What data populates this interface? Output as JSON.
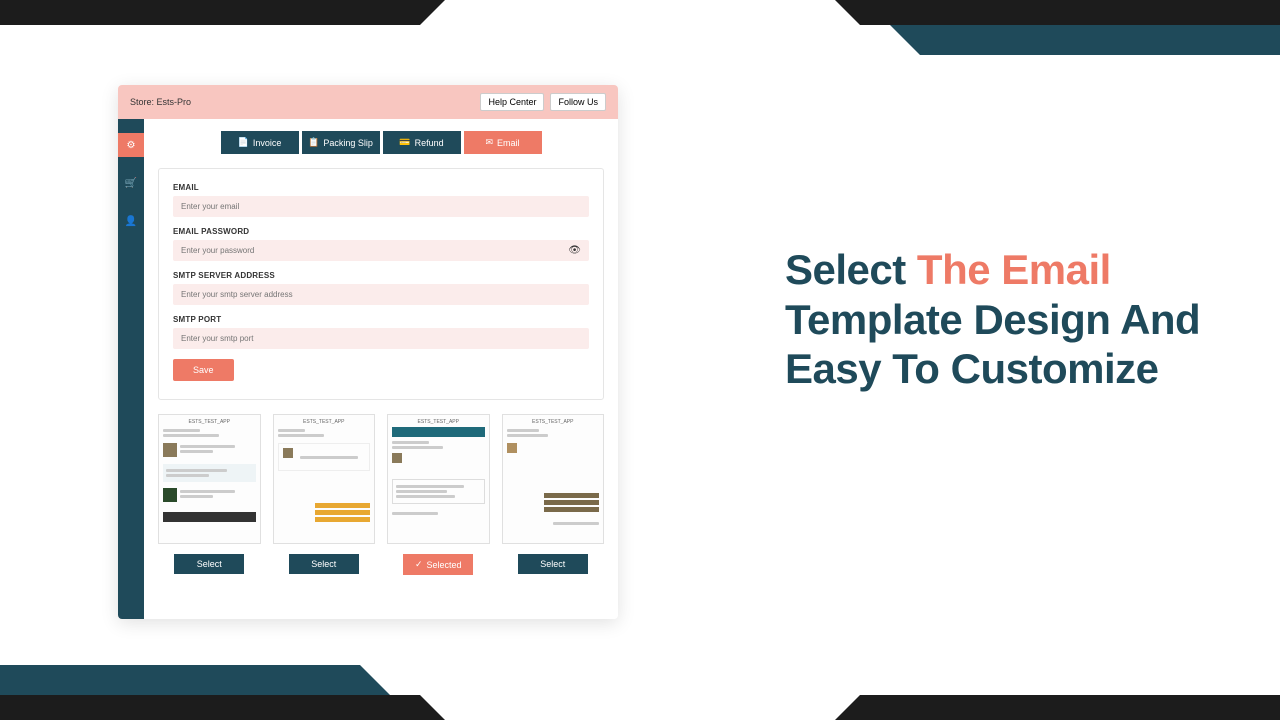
{
  "headline": {
    "part1": "Select ",
    "accent": "The Email",
    "part2": " Template Design And Easy To Customize"
  },
  "topbar": {
    "store_label": "Store:",
    "store_name": "Ests-Pro",
    "help": "Help Center",
    "follow": "Follow Us"
  },
  "tabs": {
    "invoice": "Invoice",
    "packing": "Packing Slip",
    "refund": "Refund",
    "email": "Email"
  },
  "form": {
    "email_label": "EMAIL",
    "email_ph": "Enter your email",
    "pw_label": "EMAIL PASSWORD",
    "pw_ph": "Enter your password",
    "smtp_label": "SMTP SERVER ADDRESS",
    "smtp_ph": "Enter your smtp server address",
    "port_label": "SMTP PORT",
    "port_ph": "Enter your smtp port",
    "save": "Save"
  },
  "templates": {
    "preview_title": "ESTS_TEST_APP",
    "select": "Select",
    "selected": "Selected"
  }
}
